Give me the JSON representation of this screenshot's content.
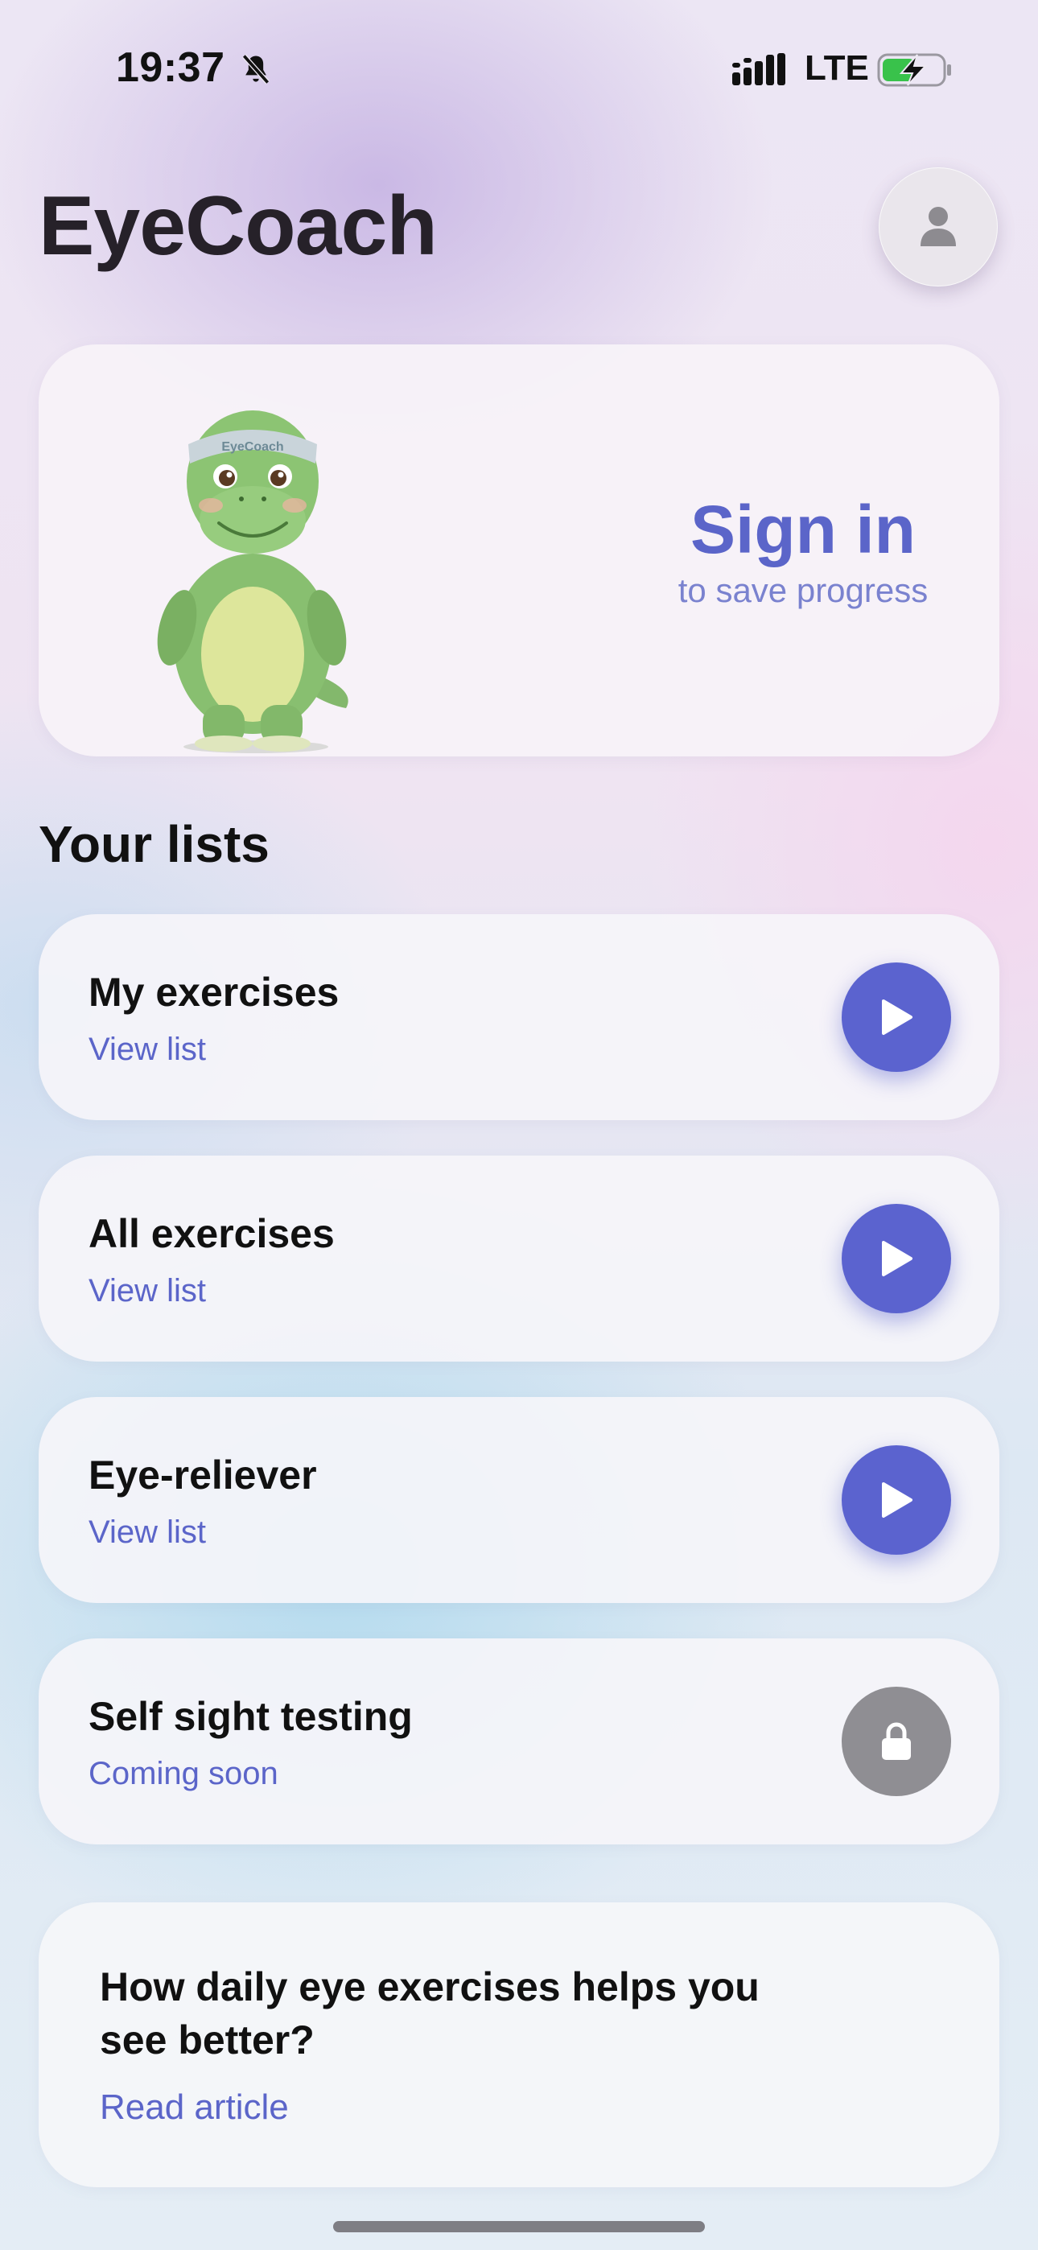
{
  "status_bar": {
    "time": "19:37",
    "network": "LTE",
    "icons": [
      "bell-slash-icon",
      "signal-icon",
      "battery-charging-icon"
    ]
  },
  "header": {
    "title": "EyeCoach",
    "profile_icon": "person-icon"
  },
  "signin_card": {
    "mascot_headband_text": "EyeCoach",
    "title": "Sign in",
    "subtitle": "to save progress"
  },
  "lists_section": {
    "title": "Your lists",
    "items": [
      {
        "title": "My exercises",
        "subtitle": "View list",
        "action_icon": "play-icon"
      },
      {
        "title": "All exercises",
        "subtitle": "View list",
        "action_icon": "play-icon"
      },
      {
        "title": "Eye-reliever",
        "subtitle": "View list",
        "action_icon": "play-icon"
      },
      {
        "title": "Self sight testing",
        "subtitle": "Coming soon",
        "action_icon": "lock-icon"
      }
    ]
  },
  "article": {
    "title": "How daily eye exercises helps you see better?",
    "link": "Read article"
  },
  "colors": {
    "accent": "#5b63cf",
    "title_text": "#262129",
    "locked": "#8f8e93"
  }
}
